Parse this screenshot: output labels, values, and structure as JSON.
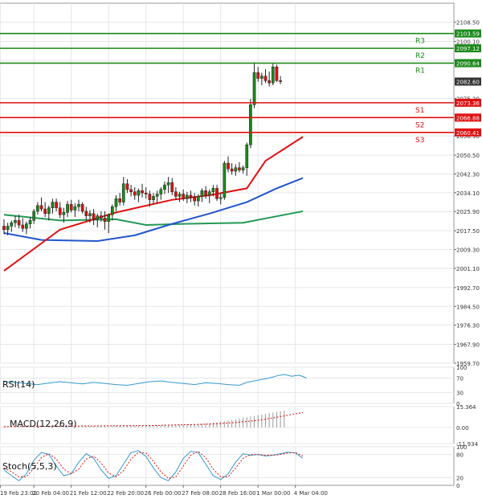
{
  "chart_data": {
    "type": "candlestick",
    "main": {
      "ylim": [
        1959.7,
        2116.8
      ],
      "yticks": [
        "2108.50",
        "2100.10",
        "2091.80",
        "2075.20",
        "2058.90",
        "2050.50",
        "2042.30",
        "2034.10",
        "2025.90",
        "2017.50",
        "2009.30",
        "2001.10",
        "1992.70",
        "1984.50",
        "1976.30",
        "1967.90",
        "1959.70"
      ],
      "current_price": "2082.60",
      "levels": [
        {
          "name": "R3",
          "value": "2103.59",
          "color": "#1a8a1a"
        },
        {
          "name": "R2",
          "value": "2097.12",
          "color": "#1a8a1a"
        },
        {
          "name": "R1",
          "value": "2090.64",
          "color": "#1a8a1a"
        },
        {
          "name": "S1",
          "value": "2073.36",
          "color": "#e01010"
        },
        {
          "name": "S2",
          "value": "2066.88",
          "color": "#e01010"
        },
        {
          "name": "S3",
          "value": "2060.41",
          "color": "#e01010"
        }
      ],
      "candles": [
        [
          2019.5,
          2022.5,
          2016.0,
          2018.0
        ],
        [
          2018.0,
          2021.0,
          2015.5,
          2019.5
        ],
        [
          2019.5,
          2022.0,
          2017.0,
          2021.0
        ],
        [
          2021.0,
          2024.0,
          2019.0,
          2022.0
        ],
        [
          2022.0,
          2024.5,
          2018.5,
          2020.0
        ],
        [
          2020.0,
          2023.0,
          2017.0,
          2018.5
        ],
        [
          2018.5,
          2021.5,
          2016.0,
          2020.5
        ],
        [
          2020.5,
          2023.5,
          2018.5,
          2022.0
        ],
        [
          2022.0,
          2027.0,
          2020.5,
          2026.0
        ],
        [
          2026.0,
          2030.0,
          2024.5,
          2028.5
        ],
        [
          2028.5,
          2032.0,
          2026.0,
          2027.0
        ],
        [
          2027.0,
          2030.0,
          2023.5,
          2025.0
        ],
        [
          2025.0,
          2028.5,
          2022.0,
          2027.5
        ],
        [
          2027.5,
          2031.5,
          2025.0,
          2030.0
        ],
        [
          2030.0,
          2031.5,
          2026.0,
          2027.5
        ],
        [
          2027.5,
          2030.0,
          2023.0,
          2024.5
        ],
        [
          2024.5,
          2027.5,
          2021.0,
          2025.5
        ],
        [
          2025.5,
          2030.5,
          2023.5,
          2029.0
        ],
        [
          2029.0,
          2031.0,
          2025.5,
          2026.5
        ],
        [
          2026.5,
          2029.5,
          2023.5,
          2028.0
        ],
        [
          2028.0,
          2031.0,
          2026.0,
          2029.0
        ],
        [
          2029.0,
          2030.0,
          2025.0,
          2026.0
        ],
        [
          2026.0,
          2028.0,
          2022.0,
          2024.0
        ],
        [
          2024.0,
          2026.5,
          2021.0,
          2025.0
        ],
        [
          2025.0,
          2027.0,
          2020.0,
          2022.5
        ],
        [
          2022.5,
          2025.0,
          2019.0,
          2024.0
        ],
        [
          2024.0,
          2026.0,
          2021.5,
          2023.0
        ],
        [
          2023.0,
          2026.0,
          2018.0,
          2021.5
        ],
        [
          2021.5,
          2025.0,
          2016.5,
          2024.5
        ],
        [
          2024.5,
          2029.0,
          2022.0,
          2028.0
        ],
        [
          2028.0,
          2033.0,
          2026.0,
          2031.5
        ],
        [
          2031.5,
          2034.0,
          2028.5,
          2030.0
        ],
        [
          2030.0,
          2041.0,
          2028.5,
          2038.0
        ],
        [
          2038.0,
          2040.0,
          2034.0,
          2035.5
        ],
        [
          2035.5,
          2037.5,
          2032.5,
          2034.5
        ],
        [
          2034.5,
          2036.5,
          2031.0,
          2033.0
        ],
        [
          2033.0,
          2036.0,
          2030.0,
          2035.0
        ],
        [
          2035.0,
          2038.0,
          2032.0,
          2034.0
        ],
        [
          2034.0,
          2036.5,
          2031.5,
          2033.5
        ],
        [
          2033.5,
          2035.0,
          2028.0,
          2031.0
        ],
        [
          2031.0,
          2034.0,
          2029.0,
          2032.5
        ],
        [
          2032.5,
          2035.0,
          2029.5,
          2033.5
        ],
        [
          2033.5,
          2036.5,
          2031.0,
          2035.5
        ],
        [
          2035.5,
          2039.0,
          2033.5,
          2037.5
        ],
        [
          2037.5,
          2041.0,
          2034.0,
          2038.5
        ],
        [
          2038.5,
          2040.5,
          2033.0,
          2034.5
        ],
        [
          2034.5,
          2036.5,
          2031.0,
          2032.5
        ],
        [
          2032.5,
          2034.5,
          2030.0,
          2033.5
        ],
        [
          2033.5,
          2035.5,
          2030.5,
          2031.5
        ],
        [
          2031.5,
          2034.5,
          2029.5,
          2033.0
        ],
        [
          2033.0,
          2035.0,
          2030.0,
          2032.0
        ],
        [
          2032.0,
          2034.0,
          2028.5,
          2030.5
        ],
        [
          2030.5,
          2033.5,
          2028.0,
          2032.5
        ],
        [
          2032.5,
          2036.0,
          2030.0,
          2035.0
        ],
        [
          2035.0,
          2037.0,
          2031.5,
          2033.0
        ],
        [
          2033.0,
          2035.5,
          2029.5,
          2034.5
        ],
        [
          2034.5,
          2037.5,
          2032.5,
          2036.0
        ],
        [
          2036.0,
          2037.5,
          2030.5,
          2031.5
        ],
        [
          2031.5,
          2034.0,
          2029.0,
          2032.0
        ],
        [
          2032.0,
          2048.0,
          2031.0,
          2047.0
        ],
        [
          2047.0,
          2050.0,
          2043.0,
          2044.5
        ],
        [
          2044.5,
          2047.0,
          2042.0,
          2043.5
        ],
        [
          2043.5,
          2046.5,
          2041.5,
          2045.0
        ],
        [
          2045.0,
          2047.5,
          2043.0,
          2044.0
        ],
        [
          2044.0,
          2046.0,
          2042.5,
          2045.0
        ],
        [
          2045.0,
          2056.0,
          2041.5,
          2055.0
        ],
        [
          2055.0,
          2075.0,
          2053.5,
          2072.5
        ],
        [
          2072.5,
          2091.0,
          2071.0,
          2086.5
        ],
        [
          2086.5,
          2089.0,
          2082.5,
          2084.0
        ],
        [
          2084.0,
          2086.5,
          2081.0,
          2085.0
        ],
        [
          2085.0,
          2088.0,
          2082.0,
          2083.0
        ],
        [
          2083.0,
          2087.0,
          2080.5,
          2082.0
        ],
        [
          2082.0,
          2090.5,
          2081.0,
          2089.0
        ],
        [
          2089.0,
          2090.0,
          2082.5,
          2083.0
        ],
        [
          2083.0,
          2085.0,
          2081.5,
          2082.6
        ]
      ],
      "ma_fast_color": "#e01010",
      "ma_mid_color": "#2255cc",
      "ma_slow_color": "#229955",
      "ma_fast": [
        [
          0,
          2000.0
        ],
        [
          15,
          2018.0
        ],
        [
          30,
          2025.5
        ],
        [
          45,
          2031.0
        ],
        [
          55,
          2033.0
        ],
        [
          65,
          2036.0
        ],
        [
          70,
          2048.0
        ],
        [
          80,
          2058.5
        ]
      ],
      "ma_mid": [
        [
          0,
          2016.5
        ],
        [
          10,
          2013.5
        ],
        [
          25,
          2013.0
        ],
        [
          35,
          2015.5
        ],
        [
          45,
          2020.5
        ],
        [
          55,
          2025.0
        ],
        [
          65,
          2030.0
        ],
        [
          73,
          2036.0
        ],
        [
          80,
          2040.5
        ]
      ],
      "ma_slow": [
        [
          0,
          2024.5
        ],
        [
          15,
          2022.0
        ],
        [
          30,
          2022.5
        ],
        [
          38,
          2020.0
        ],
        [
          48,
          2020.5
        ],
        [
          64,
          2021.0
        ],
        [
          72,
          2023.5
        ],
        [
          80,
          2026.0
        ]
      ]
    },
    "rsi": {
      "label": "RSI(14)",
      "yticks": [
        "100",
        "70",
        "30",
        "0"
      ],
      "ylim": [
        0,
        100
      ],
      "line_color": "#3399cc",
      "values": [
        [
          0,
          60
        ],
        [
          3,
          58
        ],
        [
          6,
          55
        ],
        [
          9,
          52
        ],
        [
          12,
          56
        ],
        [
          15,
          60
        ],
        [
          18,
          57
        ],
        [
          21,
          54
        ],
        [
          24,
          58
        ],
        [
          27,
          55
        ],
        [
          30,
          52
        ],
        [
          33,
          50
        ],
        [
          36,
          55
        ],
        [
          39,
          60
        ],
        [
          42,
          62
        ],
        [
          45,
          58
        ],
        [
          48,
          55
        ],
        [
          51,
          52
        ],
        [
          54,
          57
        ],
        [
          57,
          55
        ],
        [
          60,
          52
        ],
        [
          63,
          50
        ],
        [
          65,
          58
        ],
        [
          67,
          62
        ],
        [
          69,
          66
        ],
        [
          71,
          70
        ],
        [
          73,
          76
        ],
        [
          75,
          80
        ],
        [
          77,
          75
        ],
        [
          79,
          78
        ],
        [
          81,
          70
        ]
      ]
    },
    "macd": {
      "label": "MACD(12,26,9)",
      "yticks": [
        "15.364",
        "0.00",
        "-11.934"
      ],
      "ylim": [
        -11.934,
        15.364
      ],
      "hist_color": "#999999",
      "signal_color": "#e01010",
      "hist": [
        0.6,
        0.5,
        0.5,
        0.6,
        0.7,
        0.7,
        0.8,
        0.8,
        0.9,
        1.0,
        1.0,
        1.0,
        1.1,
        1.1,
        1.2,
        1.2,
        1.1,
        1.2,
        1.2,
        1.2,
        1.1,
        1.1,
        1.1,
        1.0,
        1.0,
        1.0,
        1.1,
        1.1,
        1.2,
        1.3,
        1.4,
        1.5,
        1.6,
        1.6,
        1.6,
        1.5,
        1.5,
        1.5,
        1.6,
        1.6,
        1.7,
        1.7,
        1.8,
        1.9,
        2.0,
        2.0,
        2.1,
        2.1,
        2.2,
        2.3,
        2.4,
        2.5,
        2.6,
        2.8,
        3.0,
        3.2,
        3.5,
        3.8,
        4.2,
        4.6,
        5.0,
        5.5,
        6.0,
        6.5,
        7.0,
        7.5,
        8.0,
        8.5,
        9.0,
        9.5,
        10.0,
        10.5,
        11.0,
        11.5,
        12.0,
        12.5
      ],
      "signal": [
        [
          0,
          0.6
        ],
        [
          20,
          1.0
        ],
        [
          40,
          1.4
        ],
        [
          55,
          2.4
        ],
        [
          62,
          3.6
        ],
        [
          68,
          5.2
        ],
        [
          72,
          7.0
        ],
        [
          76,
          9.0
        ],
        [
          80,
          11.0
        ]
      ]
    },
    "stoch": {
      "label": "Stoch(5,5,3)",
      "yticks": [
        "100",
        "80",
        "20",
        "0"
      ],
      "ylim": [
        0,
        100
      ],
      "main_color": "#3399cc",
      "signal_color": "#e01010",
      "main": [
        [
          0,
          40
        ],
        [
          2,
          25
        ],
        [
          4,
          12
        ],
        [
          6,
          30
        ],
        [
          8,
          65
        ],
        [
          10,
          85
        ],
        [
          12,
          80
        ],
        [
          14,
          50
        ],
        [
          16,
          25
        ],
        [
          18,
          30
        ],
        [
          20,
          60
        ],
        [
          22,
          82
        ],
        [
          24,
          70
        ],
        [
          26,
          40
        ],
        [
          28,
          18
        ],
        [
          30,
          25
        ],
        [
          32,
          55
        ],
        [
          34,
          85
        ],
        [
          36,
          90
        ],
        [
          38,
          75
        ],
        [
          40,
          45
        ],
        [
          42,
          20
        ],
        [
          44,
          12
        ],
        [
          46,
          35
        ],
        [
          48,
          70
        ],
        [
          50,
          88
        ],
        [
          52,
          85
        ],
        [
          54,
          55
        ],
        [
          56,
          25
        ],
        [
          58,
          15
        ],
        [
          60,
          30
        ],
        [
          62,
          60
        ],
        [
          64,
          82
        ],
        [
          66,
          78
        ],
        [
          68,
          80
        ],
        [
          70,
          76
        ],
        [
          72,
          78
        ],
        [
          74,
          82
        ],
        [
          76,
          86
        ],
        [
          78,
          84
        ],
        [
          80,
          70
        ]
      ],
      "signal": [
        [
          0,
          45
        ],
        [
          2,
          35
        ],
        [
          4,
          22
        ],
        [
          6,
          22
        ],
        [
          8,
          45
        ],
        [
          10,
          72
        ],
        [
          12,
          82
        ],
        [
          14,
          68
        ],
        [
          16,
          42
        ],
        [
          18,
          30
        ],
        [
          20,
          42
        ],
        [
          22,
          68
        ],
        [
          24,
          76
        ],
        [
          26,
          58
        ],
        [
          28,
          32
        ],
        [
          30,
          22
        ],
        [
          32,
          38
        ],
        [
          34,
          68
        ],
        [
          36,
          86
        ],
        [
          38,
          84
        ],
        [
          40,
          62
        ],
        [
          42,
          35
        ],
        [
          44,
          18
        ],
        [
          46,
          22
        ],
        [
          48,
          50
        ],
        [
          50,
          78
        ],
        [
          52,
          88
        ],
        [
          54,
          72
        ],
        [
          56,
          42
        ],
        [
          58,
          22
        ],
        [
          60,
          22
        ],
        [
          62,
          45
        ],
        [
          64,
          70
        ],
        [
          66,
          80
        ],
        [
          68,
          80
        ],
        [
          70,
          78
        ],
        [
          72,
          78
        ],
        [
          74,
          80
        ],
        [
          76,
          84
        ],
        [
          78,
          85
        ],
        [
          80,
          76
        ]
      ]
    },
    "x_ticks": [
      {
        "label": "19 Feb 23:01",
        "i": -1
      },
      {
        "label": "20 Feb 04:00",
        "i": 8
      },
      {
        "label": "21 Feb 12:00",
        "i": 18
      },
      {
        "label": "22 Feb 20:00",
        "i": 28
      },
      {
        "label": "26 Feb 00:00",
        "i": 38
      },
      {
        "label": "27 Feb 08:00",
        "i": 48
      },
      {
        "label": "28 Feb 16:00",
        "i": 58
      },
      {
        "label": "1 Mar 00:00",
        "i": 68
      },
      {
        "label": "4 Mar 04:00",
        "i": 78
      }
    ],
    "colors": {
      "up": "#1a8a1a",
      "down": "#e01010",
      "grid": "#e6e6e6",
      "axis": "#555555",
      "price_box": "#333333"
    }
  }
}
